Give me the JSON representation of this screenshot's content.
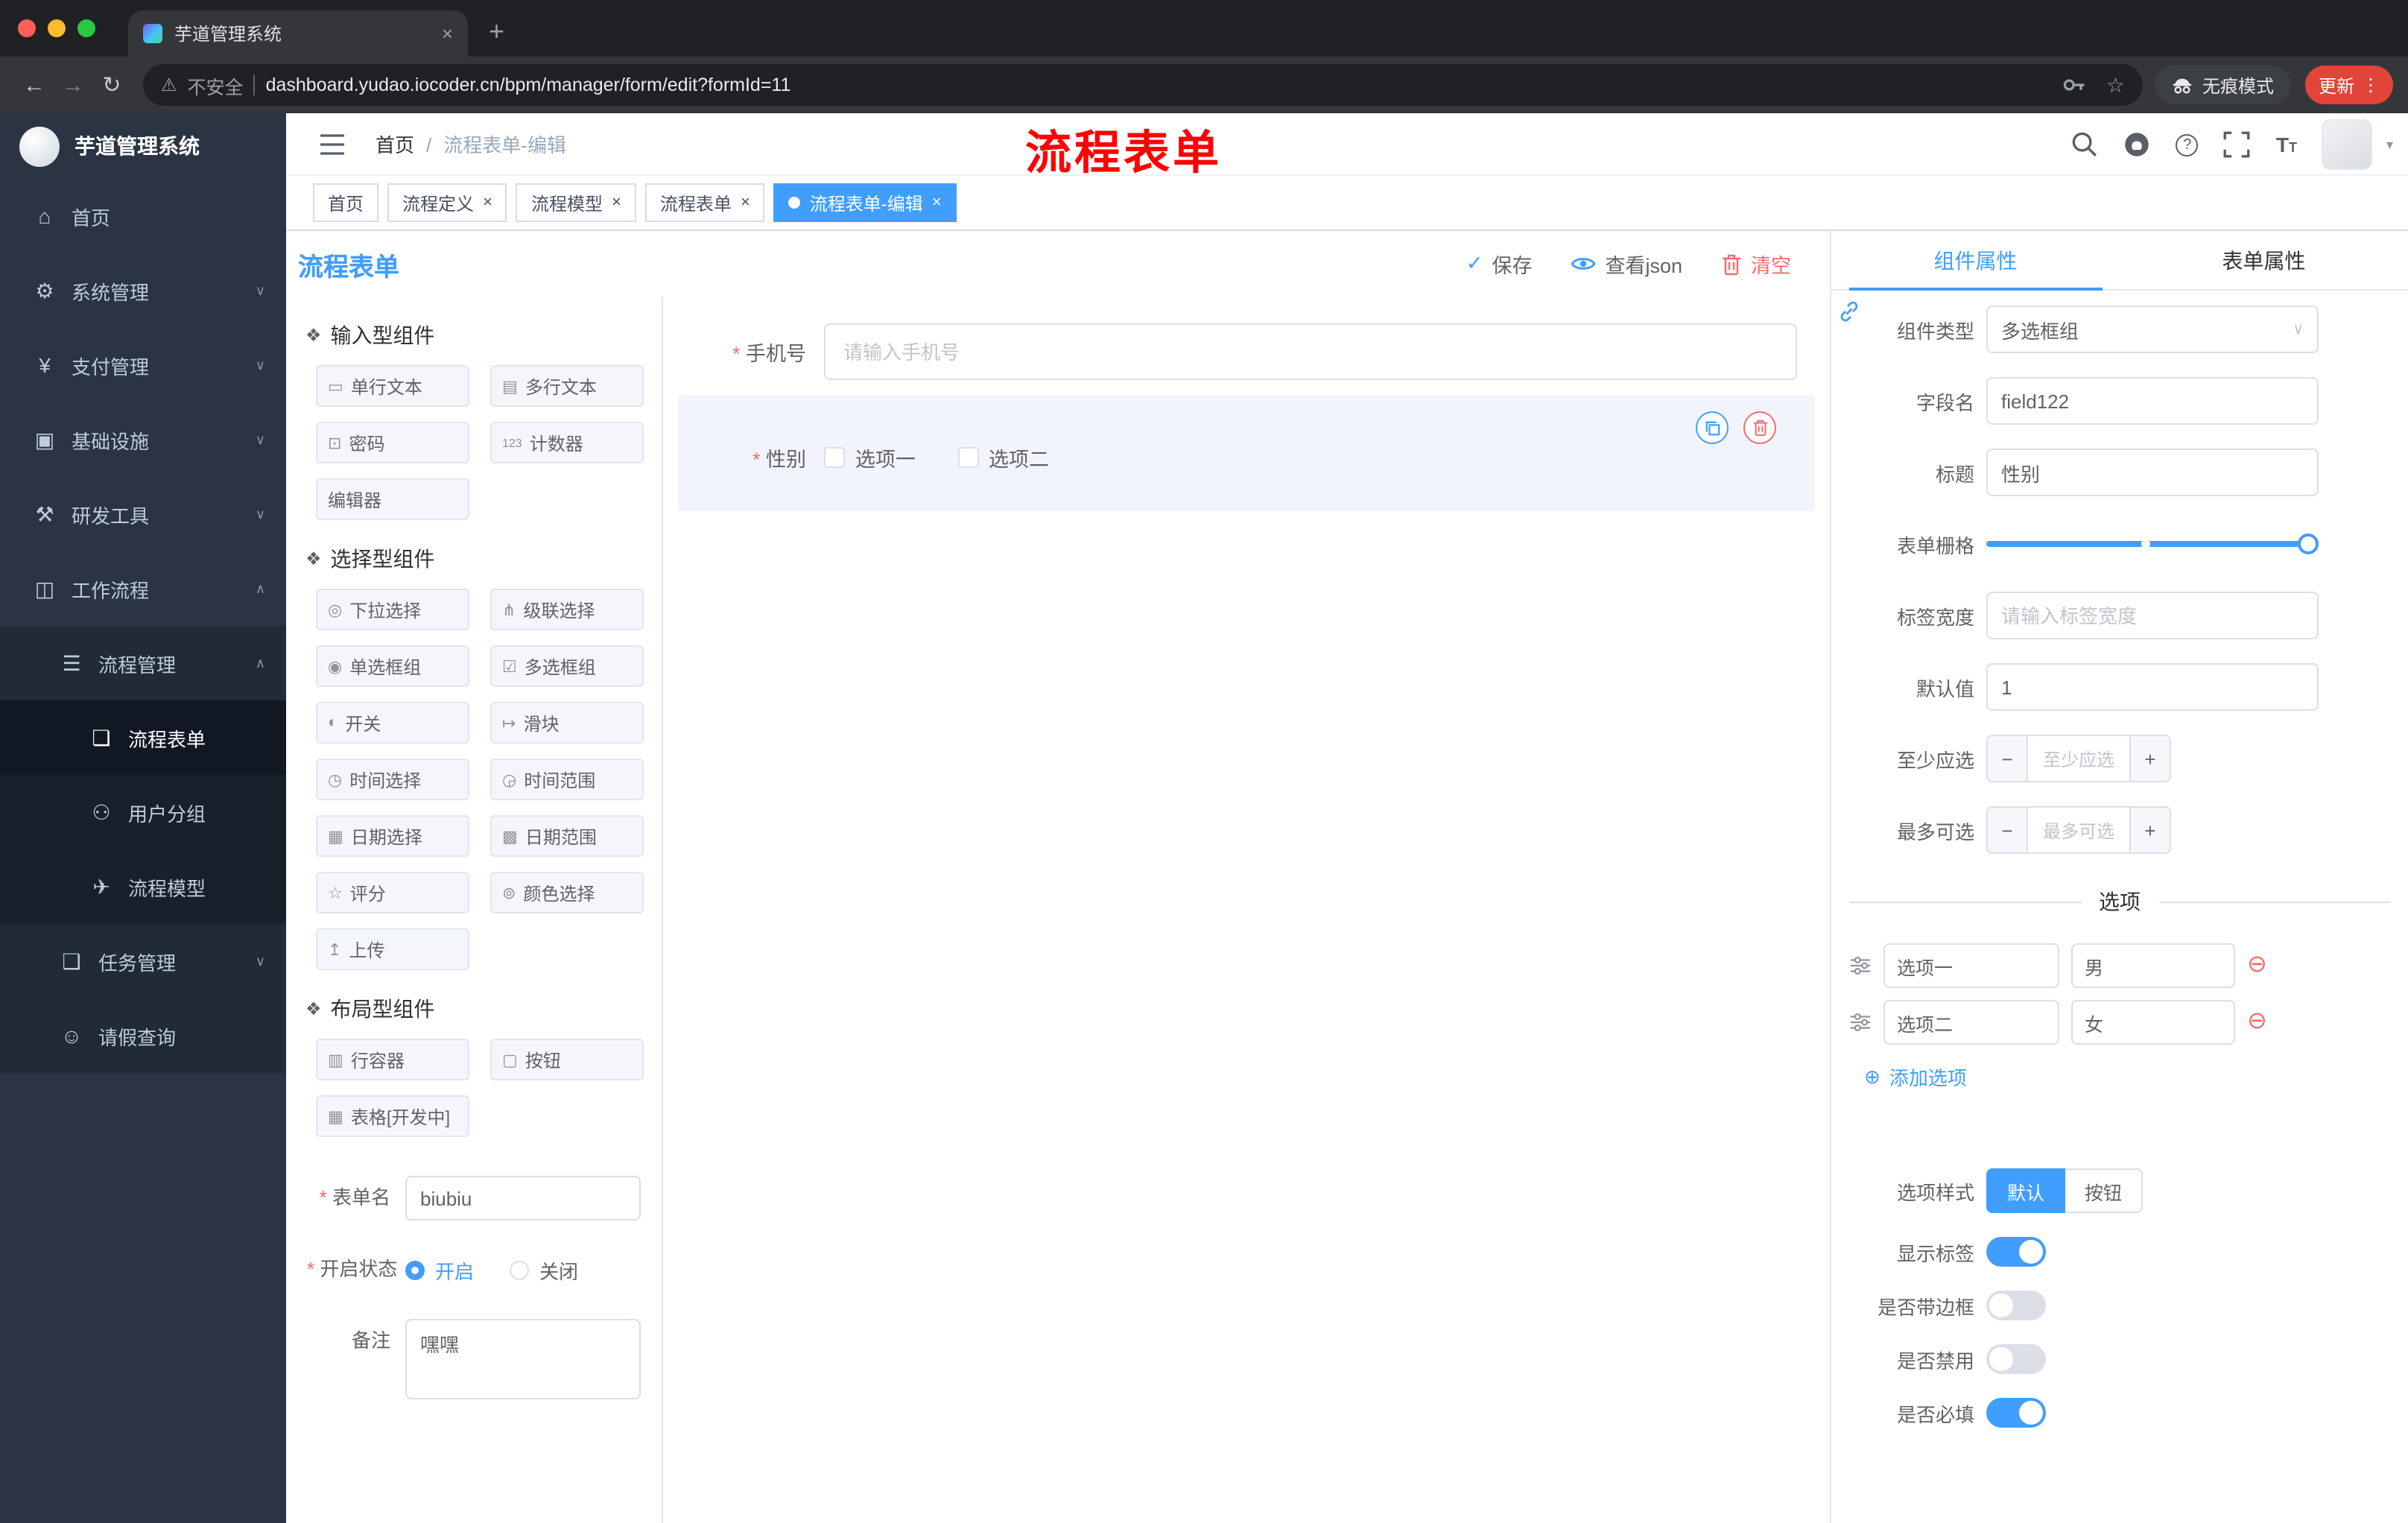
{
  "icons": {
    "chevron_down": "∨",
    "chevron_up": "∧",
    "close": "×",
    "back": "←",
    "forward": "→",
    "reload": "↻",
    "warning": "⚠",
    "star": "☆",
    "dots": "⋮",
    "new_tab": "+",
    "check": "✓",
    "minus_circle": "⊖",
    "plus_circle": "⊕",
    "caret": "▾",
    "question": "?",
    "minus": "−",
    "plus": "+",
    "section": "❖",
    "hamburger": "☰"
  },
  "colors": {
    "primary": "#409eff",
    "danger": "#f56c6c",
    "annotation": "#ff0000"
  },
  "chrome": {
    "tab_title": "芋道管理系统",
    "security_text": "不安全",
    "url": "dashboard.yudao.iocoder.cn/bpm/manager/form/edit?formId=11",
    "incognito_label": "无痕模式",
    "update_label": "更新"
  },
  "sidebar": {
    "logo_title": "芋道管理系统",
    "items": [
      {
        "label": "首页",
        "glyph": "⌂"
      },
      {
        "label": "系统管理",
        "glyph": "⚙"
      },
      {
        "label": "支付管理",
        "glyph": "¥"
      },
      {
        "label": "基础设施",
        "glyph": "▣"
      },
      {
        "label": "研发工具",
        "glyph": "⚒"
      },
      {
        "label": "工作流程",
        "glyph": "◫"
      },
      {
        "label": "流程管理",
        "glyph": "☰"
      },
      {
        "label": "流程表单",
        "glyph": "❏"
      },
      {
        "label": "用户分组",
        "glyph": "⚇"
      },
      {
        "label": "流程模型",
        "glyph": "✈"
      },
      {
        "label": "任务管理",
        "glyph": "❑"
      },
      {
        "label": "请假查询",
        "glyph": "☺"
      }
    ]
  },
  "header": {
    "breadcrumb_home": "首页",
    "breadcrumb_sep": "/",
    "breadcrumb_current": "流程表单-编辑",
    "annotation": "流程表单"
  },
  "tags": [
    {
      "label": "首页"
    },
    {
      "label": "流程定义"
    },
    {
      "label": "流程模型"
    },
    {
      "label": "流程表单"
    },
    {
      "label": "流程表单-编辑"
    }
  ],
  "designer": {
    "title": "流程表单",
    "save_label": "保存",
    "view_json_label": "查看json",
    "clear_label": "清空",
    "sections": [
      {
        "title": "输入型组件",
        "items": [
          {
            "label": "单行文本",
            "glyph": "▭"
          },
          {
            "label": "多行文本",
            "glyph": "▤"
          },
          {
            "label": "密码",
            "glyph": "⊡"
          },
          {
            "label": "计数器",
            "glyph": "123"
          },
          {
            "label": "编辑器",
            "glyph": ""
          }
        ]
      },
      {
        "title": "选择型组件",
        "items": [
          {
            "label": "下拉选择",
            "glyph": "◎"
          },
          {
            "label": "级联选择",
            "glyph": "⋔"
          },
          {
            "label": "单选框组",
            "glyph": "◉"
          },
          {
            "label": "多选框组",
            "glyph": "☑"
          },
          {
            "label": "开关",
            "glyph": "◐"
          },
          {
            "label": "滑块",
            "glyph": "↦"
          },
          {
            "label": "时间选择",
            "glyph": "◷"
          },
          {
            "label": "时间范围",
            "glyph": "◶"
          },
          {
            "label": "日期选择",
            "glyph": "▦"
          },
          {
            "label": "日期范围",
            "glyph": "▩"
          },
          {
            "label": "评分",
            "glyph": "☆"
          },
          {
            "label": "颜色选择",
            "glyph": "⊚"
          },
          {
            "label": "上传",
            "glyph": "↥"
          }
        ]
      },
      {
        "title": "布局型组件",
        "items": [
          {
            "label": "行容器",
            "glyph": "▥"
          },
          {
            "label": "按钮",
            "glyph": "▢"
          },
          {
            "label": "表格[开发中]",
            "glyph": "▦"
          }
        ]
      }
    ],
    "meta": {
      "name_label": "表单名",
      "name_value": "biubiu",
      "status_label": "开启状态",
      "status_on": "开启",
      "status_off": "关闭",
      "remark_label": "备注",
      "remark_value": "嘿嘿"
    }
  },
  "canvas": {
    "phone_label": "手机号",
    "phone_placeholder": "请输入手机号",
    "gender_label": "性别",
    "option1": "选项一",
    "option2": "选项二"
  },
  "props": {
    "tab_component": "组件属性",
    "tab_form": "表单属性",
    "component_type_label": "组件类型",
    "component_type_value": "多选框组",
    "field_label": "字段名",
    "field_value": "field122",
    "title_label": "标题",
    "title_value": "性别",
    "grid_label": "表单栅格",
    "label_width_label": "标签宽度",
    "label_width_placeholder": "请输入标签宽度",
    "default_label": "默认值",
    "default_value": "1",
    "min_label": "至少应选",
    "min_placeholder": "至少应选",
    "max_label": "最多可选",
    "max_placeholder": "最多可选",
    "options_title": "选项",
    "options": [
      {
        "label": "选项一",
        "value": "男"
      },
      {
        "label": "选项二",
        "value": "女"
      }
    ],
    "add_option": "添加选项",
    "style_label": "选项样式",
    "style_default": "默认",
    "style_button": "按钮",
    "show_label_label": "显示标签",
    "border_label": "是否带边框",
    "disabled_label": "是否禁用",
    "required_label": "是否必填"
  }
}
